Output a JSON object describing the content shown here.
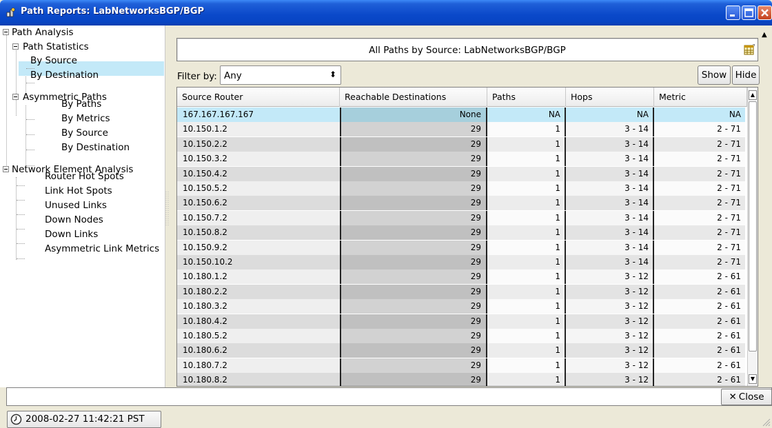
{
  "window": {
    "title": "Path Reports: LabNetworksBGP/BGP"
  },
  "tree": {
    "nodes": [
      {
        "label": "Path Analysis",
        "level": 0
      },
      {
        "label": "Path Statistics",
        "level": 1
      },
      {
        "label": "By Source",
        "level": 2,
        "selected": true
      },
      {
        "label": "By Destination",
        "level": 2
      },
      {
        "label": "Asymmetric Paths",
        "level": 1
      },
      {
        "label": "By Paths",
        "level": 2
      },
      {
        "label": "By Metrics",
        "level": 2
      },
      {
        "label": "By Source",
        "level": 2
      },
      {
        "label": "By Destination",
        "level": 2
      },
      {
        "label": "Network Element Analysis",
        "level": 0
      },
      {
        "label": "Router Hot Spots",
        "level": 1
      },
      {
        "label": "Link Hot Spots",
        "level": 1
      },
      {
        "label": "Unused Links",
        "level": 1
      },
      {
        "label": "Down Nodes",
        "level": 1
      },
      {
        "label": "Down Links",
        "level": 1
      },
      {
        "label": "Asymmetric Link Metrics",
        "level": 1
      }
    ]
  },
  "report": {
    "title": "All Paths by Source: LabNetworksBGP/BGP",
    "filter_label": "Filter by:",
    "filter_value": "Any",
    "show_label": "Show",
    "hide_label": "Hide",
    "columns": [
      "Source Router",
      "Reachable Destinations",
      "Paths",
      "Hops",
      "Metric"
    ],
    "rows": [
      [
        "167.167.167.167",
        "None",
        "NA",
        "NA",
        "NA"
      ],
      [
        "10.150.1.2",
        "29",
        "1",
        "3 - 14",
        "2 - 71"
      ],
      [
        "10.150.2.2",
        "29",
        "1",
        "3 - 14",
        "2 - 71"
      ],
      [
        "10.150.3.2",
        "29",
        "1",
        "3 - 14",
        "2 - 71"
      ],
      [
        "10.150.4.2",
        "29",
        "1",
        "3 - 14",
        "2 - 71"
      ],
      [
        "10.150.5.2",
        "29",
        "1",
        "3 - 14",
        "2 - 71"
      ],
      [
        "10.150.6.2",
        "29",
        "1",
        "3 - 14",
        "2 - 71"
      ],
      [
        "10.150.7.2",
        "29",
        "1",
        "3 - 14",
        "2 - 71"
      ],
      [
        "10.150.8.2",
        "29",
        "1",
        "3 - 14",
        "2 - 71"
      ],
      [
        "10.150.9.2",
        "29",
        "1",
        "3 - 14",
        "2 - 71"
      ],
      [
        "10.150.10.2",
        "29",
        "1",
        "3 - 14",
        "2 - 71"
      ],
      [
        "10.180.1.2",
        "29",
        "1",
        "3 - 12",
        "2 - 61"
      ],
      [
        "10.180.2.2",
        "29",
        "1",
        "3 - 12",
        "2 - 61"
      ],
      [
        "10.180.3.2",
        "29",
        "1",
        "3 - 12",
        "2 - 61"
      ],
      [
        "10.180.4.2",
        "29",
        "1",
        "3 - 12",
        "2 - 61"
      ],
      [
        "10.180.5.2",
        "29",
        "1",
        "3 - 12",
        "2 - 61"
      ],
      [
        "10.180.6.2",
        "29",
        "1",
        "3 - 12",
        "2 - 61"
      ],
      [
        "10.180.7.2",
        "29",
        "1",
        "3 - 12",
        "2 - 61"
      ],
      [
        "10.180.8.2",
        "29",
        "1",
        "3 - 12",
        "2 - 61"
      ]
    ]
  },
  "footer": {
    "close_label": "Close",
    "timestamp": "2008-02-27 11:42:21 PST"
  },
  "icons": {
    "window_icon": "app-icon",
    "configure_columns": "table-config-icon",
    "clock": "clock-icon"
  },
  "colors": {
    "titlebar": "#0a48c9",
    "selection": "#c3e9f8"
  }
}
